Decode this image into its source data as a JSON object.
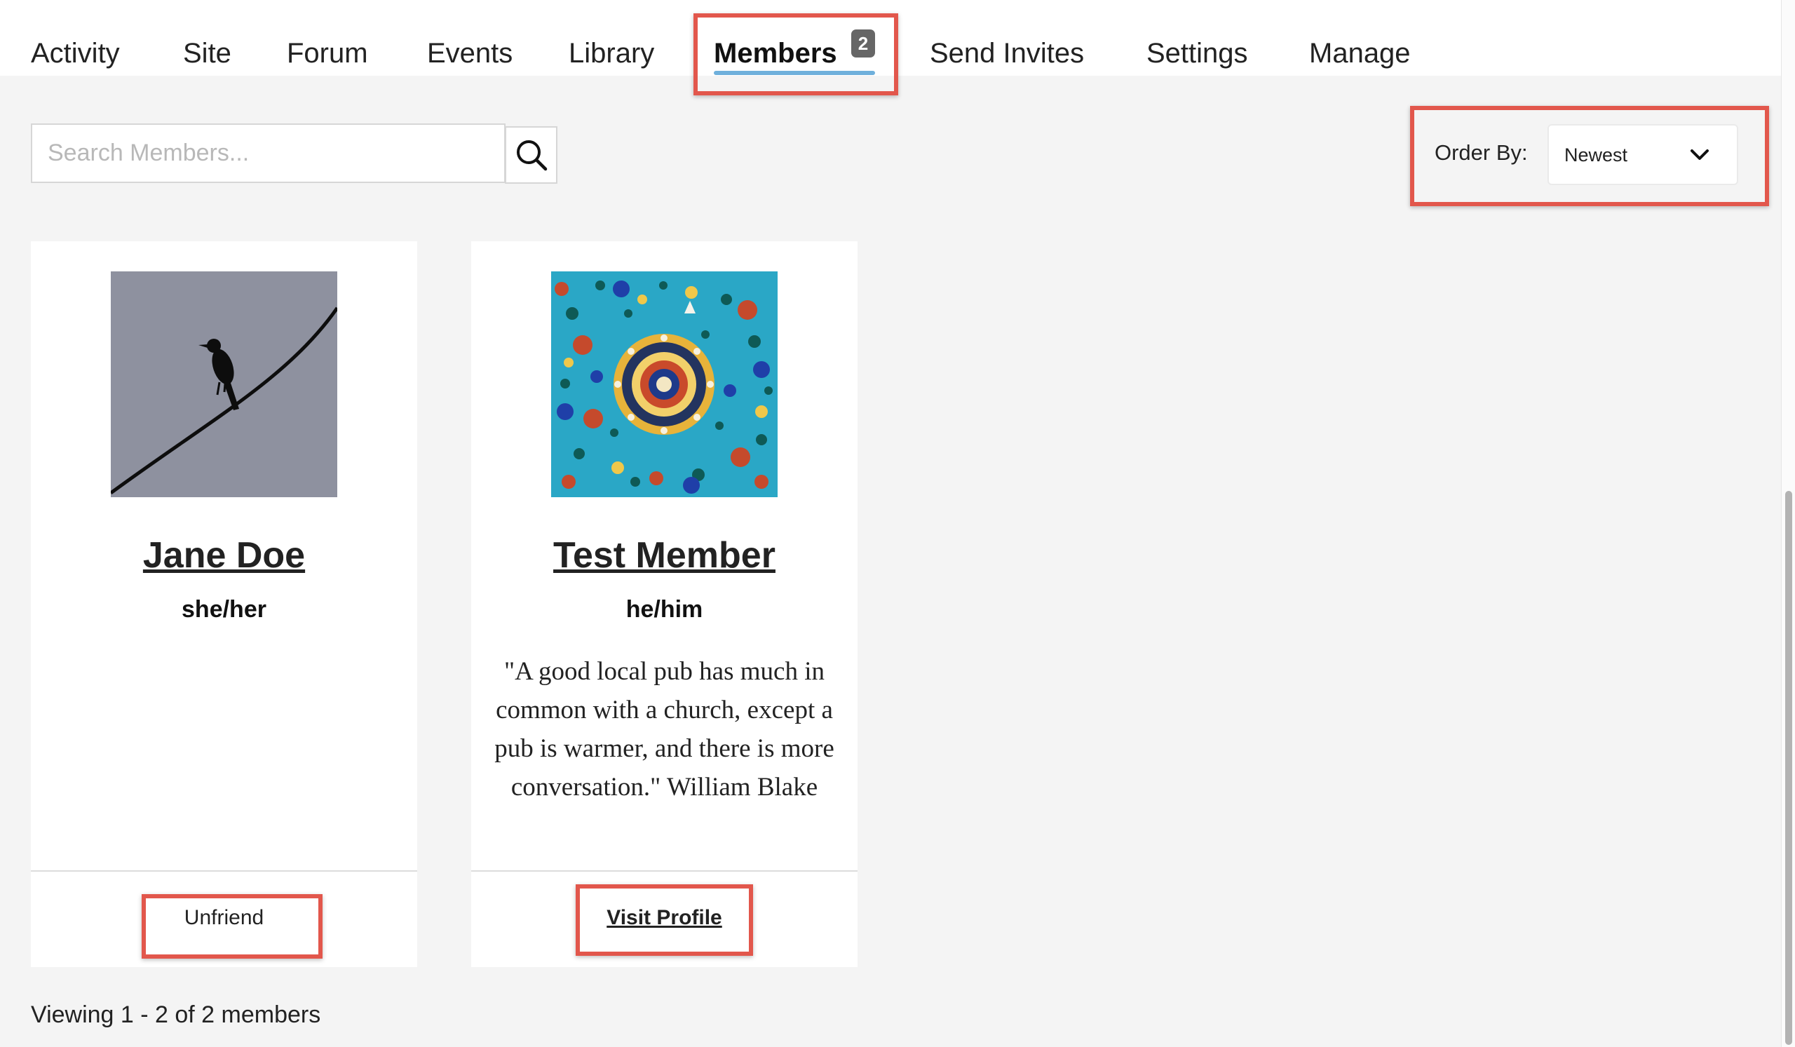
{
  "tabs": [
    {
      "label": "Activity"
    },
    {
      "label": "Site"
    },
    {
      "label": "Forum"
    },
    {
      "label": "Events"
    },
    {
      "label": "Library"
    },
    {
      "label": "Members",
      "badge": "2",
      "active": true
    },
    {
      "label": "Send Invites"
    },
    {
      "label": "Settings"
    },
    {
      "label": "Manage"
    }
  ],
  "search": {
    "placeholder": "Search Members...",
    "button_icon": "search-icon"
  },
  "order_by": {
    "label": "Order By:",
    "selected": "Newest",
    "icon": "chevron-down-icon"
  },
  "members": [
    {
      "name": "Jane Doe",
      "pronouns": "she/her",
      "bio": "",
      "avatar": "bird-on-wire",
      "action": "Unfriend"
    },
    {
      "name": "Test Member",
      "pronouns": "he/him",
      "bio": "\"A good local pub has much in common with a church, except a pub is warmer, and there is more conversation.\" William Blake",
      "avatar": "mosaic-tile",
      "action": "Visit Profile"
    }
  ],
  "footer": {
    "count_text": "Viewing 1 - 2 of 2 members"
  },
  "colors": {
    "highlight": "#e2574c",
    "tab_underline": "#6fb0dc",
    "background": "#f4f4f4"
  }
}
